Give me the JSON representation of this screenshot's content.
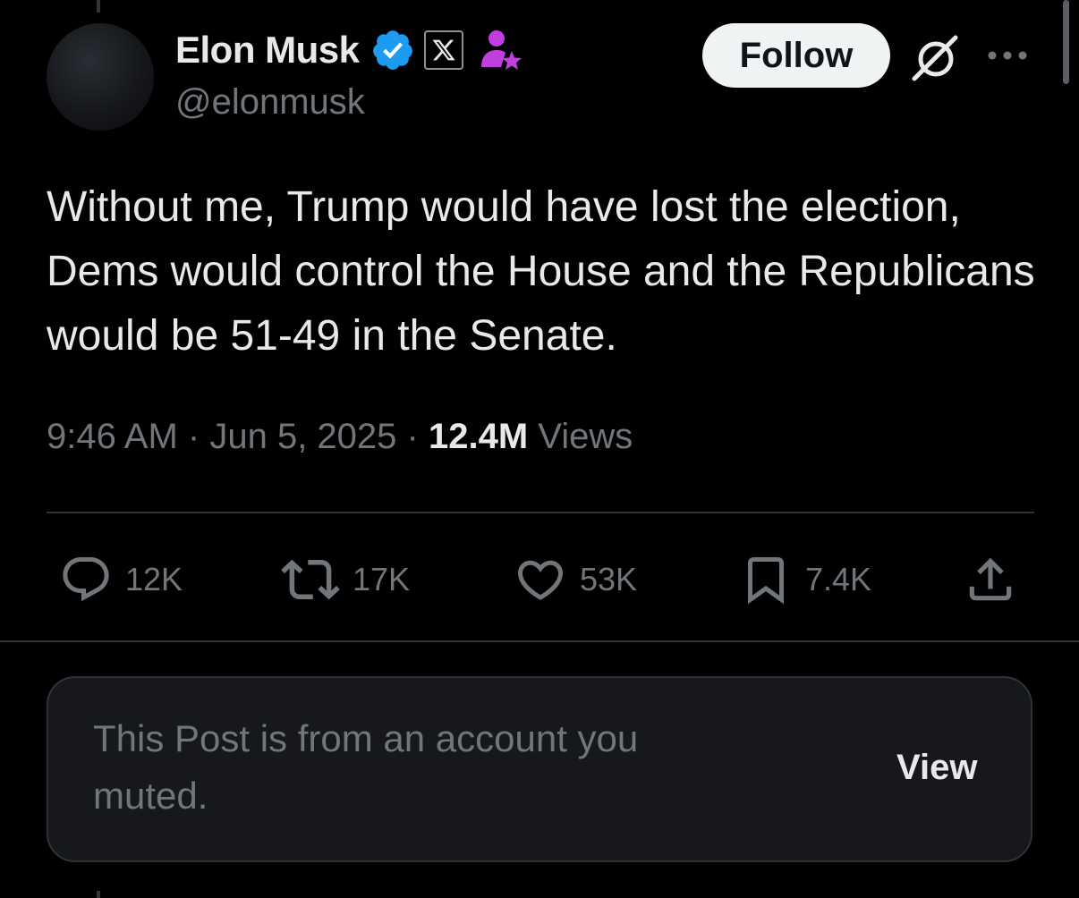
{
  "post": {
    "author": {
      "display_name": "Elon Musk",
      "handle": "@elonmusk",
      "badges": [
        "verified-badge-icon",
        "x-affiliate-badge-icon",
        "person-star-icon"
      ]
    },
    "follow_label": "Follow",
    "text": "Without me, Trump would have lost the election, Dems would control the House and the Republicans would be 51-49 in the Senate.",
    "time": "9:46 AM",
    "date": "Jun 5, 2025",
    "separator": "·",
    "views_count": "12.4M",
    "views_label": "Views"
  },
  "actions": {
    "replies": "12K",
    "reposts": "17K",
    "likes": "53K",
    "bookmarks": "7.4K"
  },
  "muted_notice": {
    "text": "This Post is from an account you muted.",
    "view_label": "View"
  },
  "colors": {
    "background": "#000000",
    "primary_text": "#e7e9ea",
    "secondary_text": "#71767b",
    "verified_blue": "#1d9bf0",
    "badge_purple": "#c13ee0",
    "divider": "#2f3336",
    "card_background": "#16181c"
  }
}
